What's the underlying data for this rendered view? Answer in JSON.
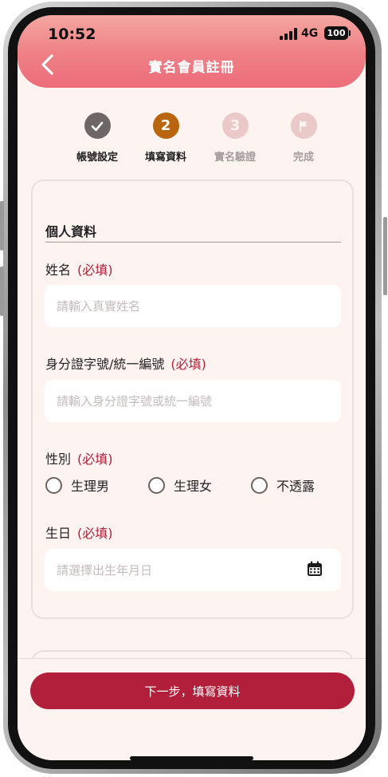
{
  "status_bar": {
    "time": "10:52",
    "network": "4G",
    "battery": "100"
  },
  "header": {
    "title": "實名會員註冊"
  },
  "steps": [
    {
      "label": "帳號設定",
      "state": "done",
      "glyph": ""
    },
    {
      "label": "填寫資料",
      "state": "active",
      "glyph": "2"
    },
    {
      "label": "實名驗證",
      "state": "pending",
      "glyph": "3"
    },
    {
      "label": "完成",
      "state": "pending",
      "glyph": ""
    }
  ],
  "form": {
    "section_title": "個人資料",
    "required_mark": "(必填)",
    "name": {
      "label": "姓名",
      "placeholder": "請輸入真實姓名"
    },
    "id_number": {
      "label": "身分證字號/統一編號",
      "placeholder": "請輸入身分證字號或統一編號"
    },
    "gender": {
      "label": "性別",
      "options": [
        "生理男",
        "生理女",
        "不透露"
      ]
    },
    "birthday": {
      "label": "生日",
      "placeholder": "請選擇出生年月日"
    }
  },
  "next_button": {
    "label": "下一步，填寫資料"
  },
  "colors": {
    "accent": "#b21f3b",
    "active_step": "#b9650d",
    "header": "#ef7f85"
  },
  "icons": [
    "back-chevron-icon",
    "checkmark-icon",
    "flag-icon",
    "calendar-icon"
  ]
}
